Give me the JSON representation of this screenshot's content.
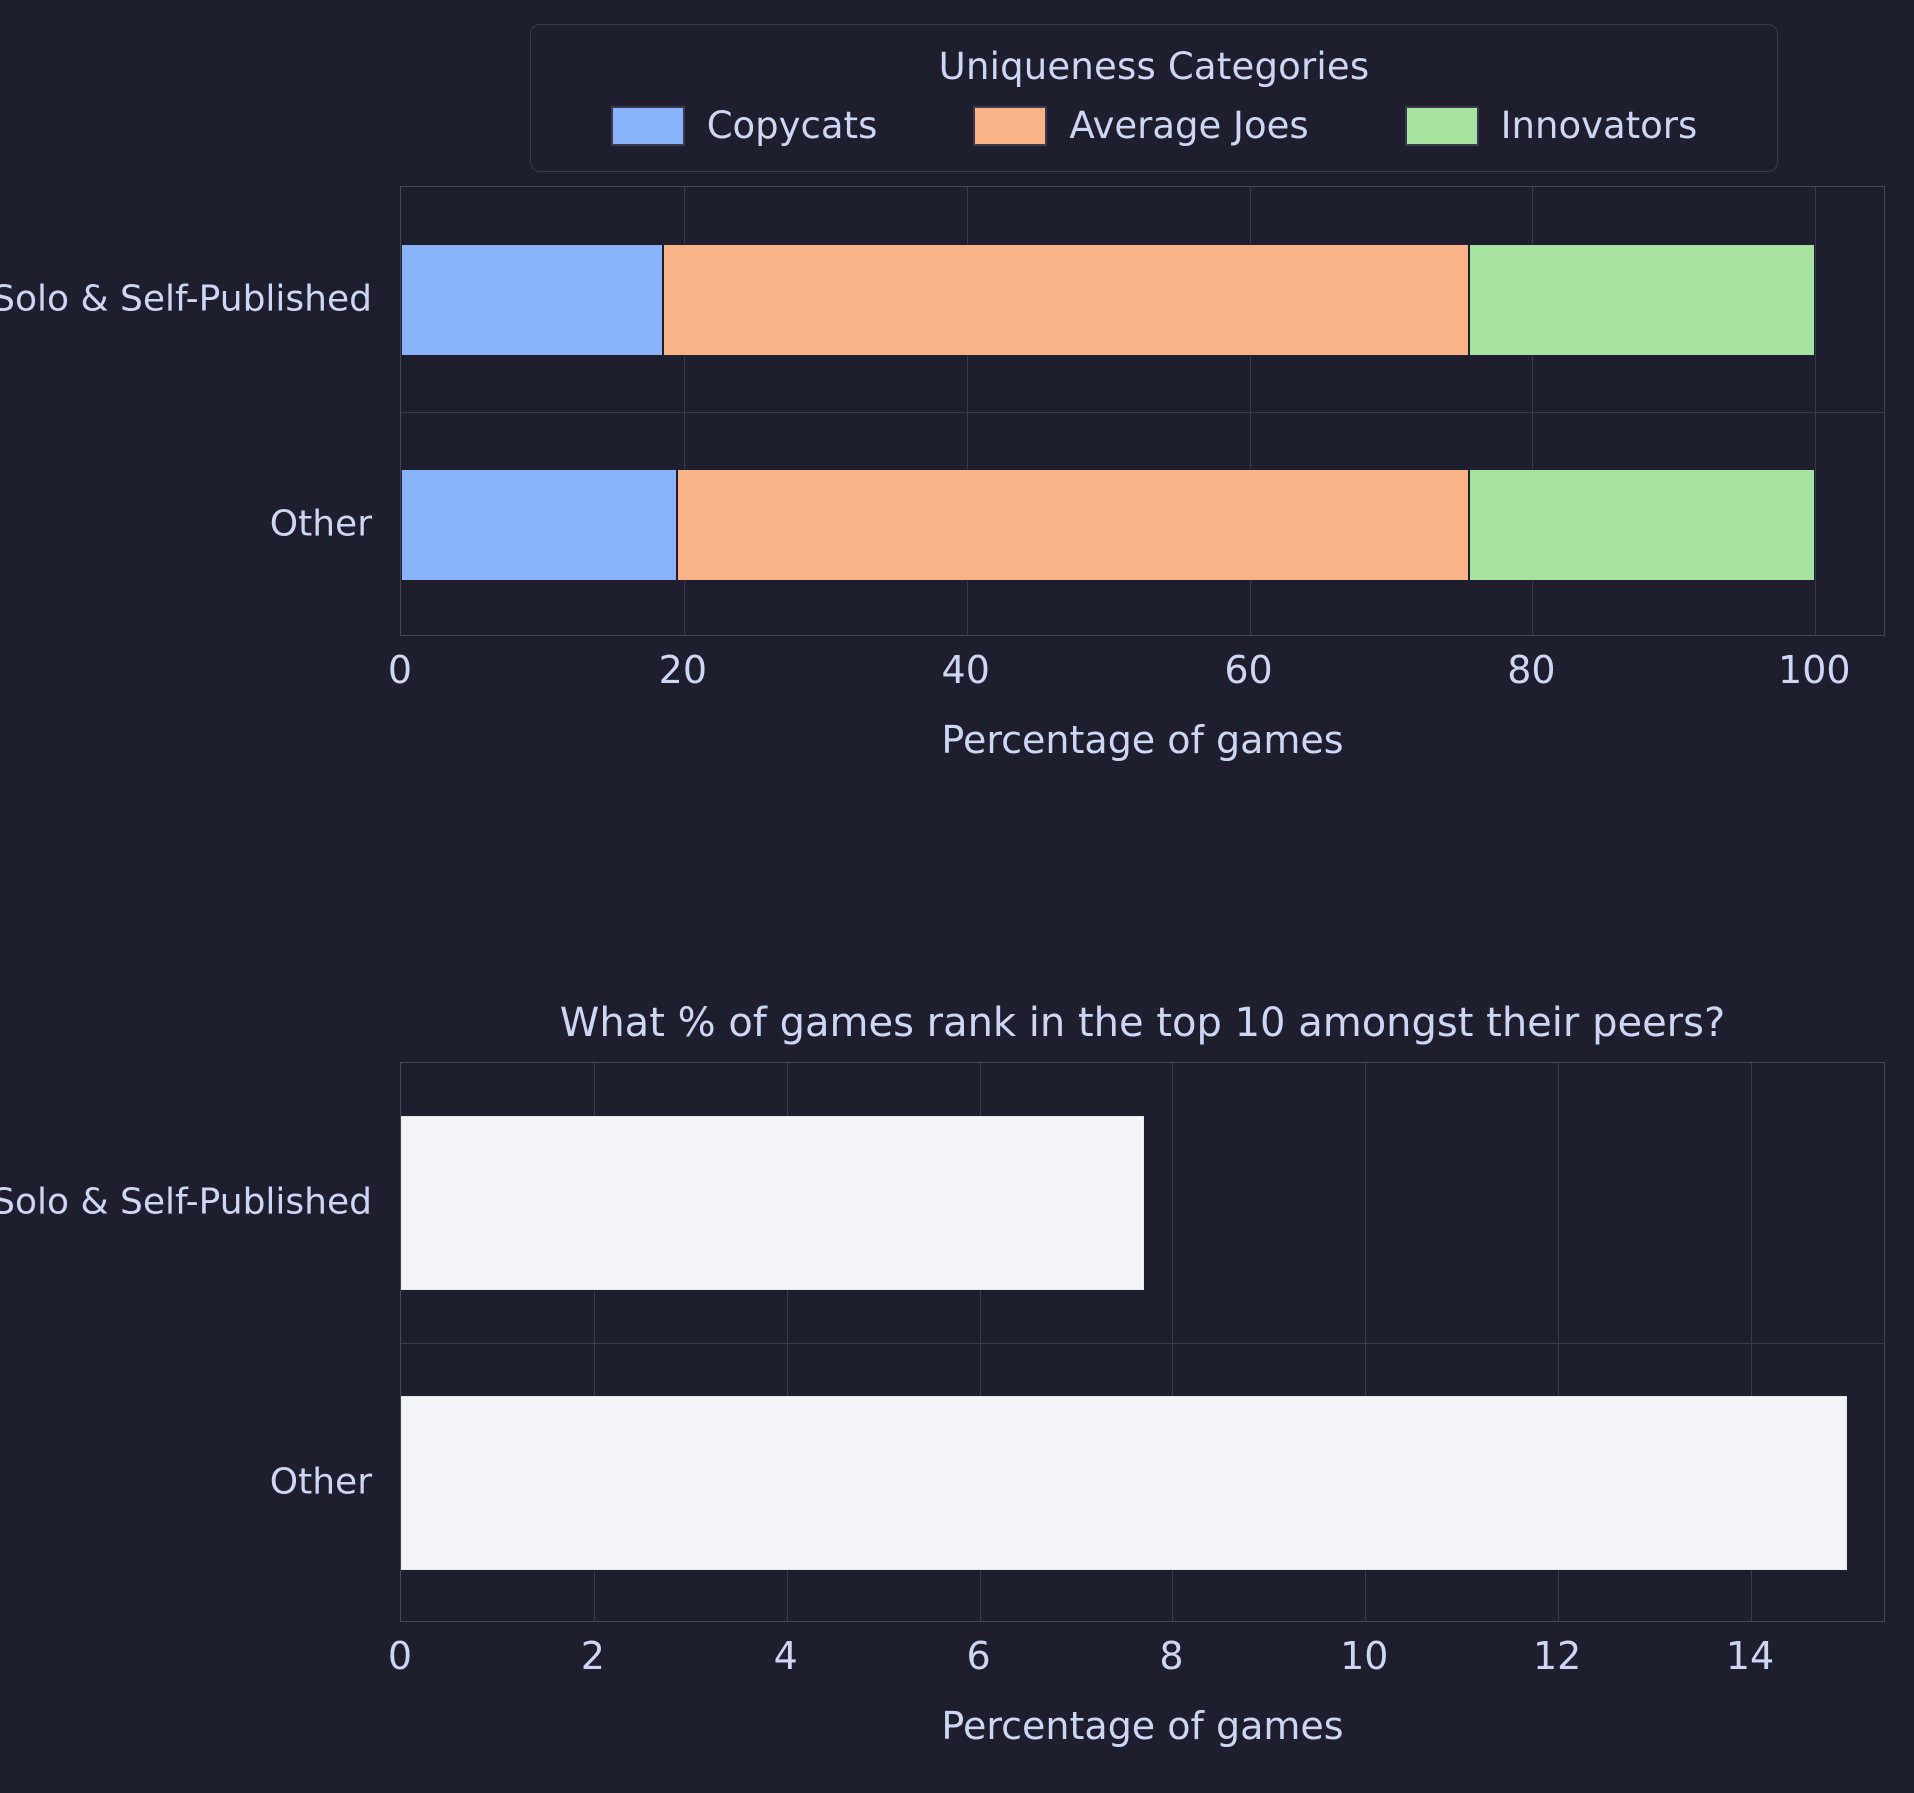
{
  "legend": {
    "title": "Uniqueness Categories",
    "items": [
      {
        "label": "Copycats",
        "color": "#89b4fa"
      },
      {
        "label": "Average Joes",
        "color": "#fab387"
      },
      {
        "label": "Innovators",
        "color": "#a6e3a1"
      }
    ]
  },
  "theme": {
    "background": "#1e1e2e",
    "text": "#cdd6f4",
    "grid": "#3a3a4f",
    "bar_white": "#f5f5f7"
  },
  "chart_data": [
    {
      "type": "bar",
      "orientation": "horizontal",
      "stacked": true,
      "normalized": true,
      "title": "",
      "xlabel": "Percentage of games",
      "ylabel": "",
      "categories": [
        "Solo & Self-Published",
        "Other"
      ],
      "xticks": [
        "0",
        "20",
        "40",
        "60",
        "80",
        "100"
      ],
      "xtick_values": [
        0,
        20,
        40,
        60,
        80,
        100
      ],
      "xlim": [
        0,
        105
      ],
      "grid": true,
      "legend_position": "above",
      "series": [
        {
          "name": "Copycats",
          "color": "#89b4fa",
          "values": [
            18.5,
            19.5
          ]
        },
        {
          "name": "Average Joes",
          "color": "#fab387",
          "values": [
            57.0,
            56.0
          ]
        },
        {
          "name": "Innovators",
          "color": "#a6e3a1",
          "values": [
            24.5,
            24.5
          ]
        }
      ]
    },
    {
      "type": "bar",
      "orientation": "horizontal",
      "stacked": false,
      "title": "What % of games rank in the top 10 amongst their peers?",
      "xlabel": "Percentage of games",
      "ylabel": "",
      "categories": [
        "Solo & Self-Published",
        "Other"
      ],
      "xticks": [
        "0",
        "2",
        "4",
        "6",
        "8",
        "10",
        "12",
        "14"
      ],
      "xtick_values": [
        0,
        2,
        4,
        6,
        8,
        10,
        12,
        14
      ],
      "xlim": [
        0,
        15.4
      ],
      "grid": true,
      "bar_color": "#f5f5f7",
      "series": [
        {
          "name": "Percentage of games",
          "color": "#f5f5f7",
          "values": [
            7.7,
            15.0
          ]
        }
      ]
    }
  ]
}
